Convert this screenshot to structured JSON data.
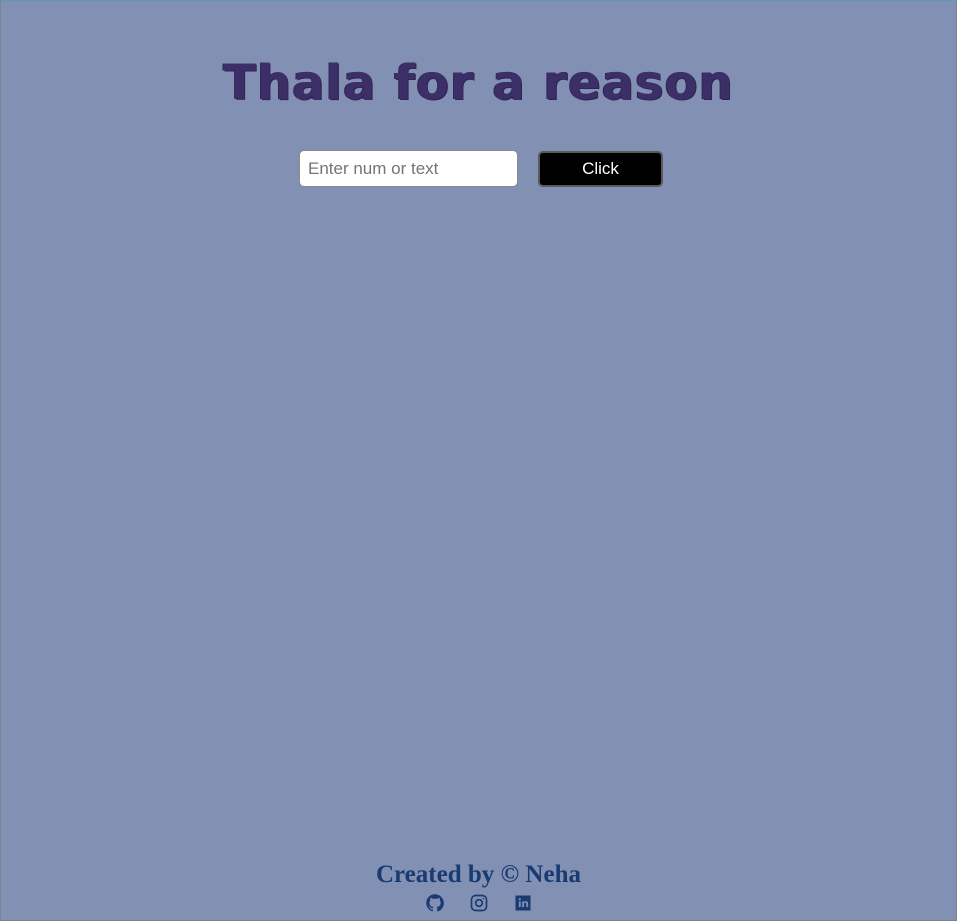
{
  "header": {
    "title": "Thala for a reason"
  },
  "form": {
    "input_placeholder": "Enter num or text",
    "input_value": "",
    "button_label": "Click"
  },
  "footer": {
    "credit": "Created by © Neha",
    "socials": [
      {
        "icon": "github-icon"
      },
      {
        "icon": "instagram-icon"
      },
      {
        "icon": "linkedin-icon"
      }
    ]
  },
  "colors": {
    "background": "#8190b3",
    "title": "#3c2f67",
    "footer": "#1a3a72",
    "button_bg": "#000000"
  }
}
